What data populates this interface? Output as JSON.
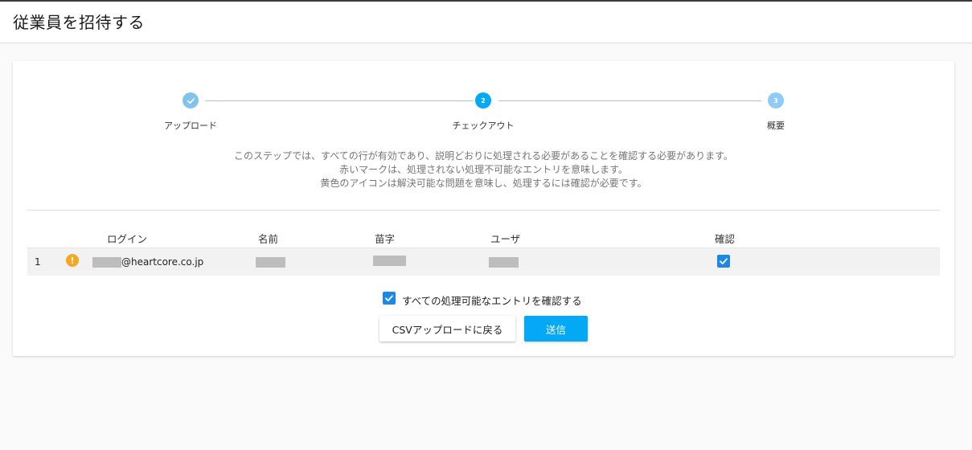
{
  "header": {
    "title": "従業員を招待する"
  },
  "stepper": {
    "steps": [
      {
        "label": "アップロード",
        "number": "1",
        "status": "done",
        "icon": "check-icon"
      },
      {
        "label": "チェックアウト",
        "number": "2",
        "status": "active"
      },
      {
        "label": "概要",
        "number": "3",
        "status": "pending"
      }
    ]
  },
  "description": {
    "line1": "このステップでは、すべての行が有効であり、説明どおりに処理される必要があることを確認する必要があります。",
    "line2": "赤いマークは、処理されない処理不可能なエントリを意味します。",
    "line3": "黄色のアイコンは解決可能な問題を意味し、処理するには確認が必要です。"
  },
  "table": {
    "columns": {
      "login": "ログイン",
      "first_name": "名前",
      "last_name": "苗字",
      "user": "ユーザ",
      "confirm": "確認"
    },
    "rows": [
      {
        "index": "1",
        "status_icon": "warning-icon",
        "login_suffix": "@heartcore.co.jp",
        "confirmed": true
      }
    ]
  },
  "confirm_all": {
    "label": "すべての処理可能なエントリを確認する",
    "checked": true
  },
  "actions": {
    "back_label": "CSVアップロードに戻る",
    "submit_label": "送信"
  },
  "colors": {
    "accent": "#03a9f4",
    "checkbox": "#1e88e5",
    "warning": "#f5a623",
    "done_step": "#81c4eb",
    "pending_step": "#90caf9"
  }
}
